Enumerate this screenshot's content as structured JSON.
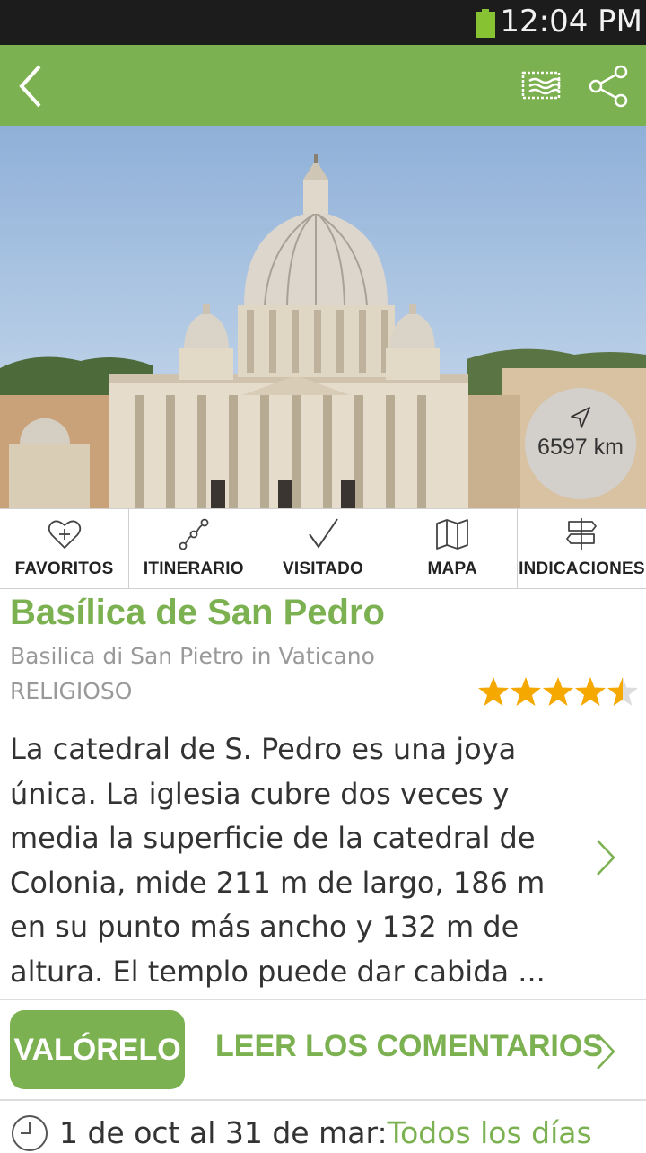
{
  "status_bar": {
    "time": "12:04 PM",
    "battery_color": "#86c232"
  },
  "app_bar": {
    "color": "#7cb151",
    "icons": [
      "back-arrow-icon",
      "postcard-icon",
      "share-icon"
    ]
  },
  "hero": {
    "distance": "6597 km",
    "icon": "navigation-arrow-icon"
  },
  "actions": [
    {
      "label": "FAVORITOS",
      "icon": "heart-plus-icon"
    },
    {
      "label": "ITINERARIO",
      "icon": "route-icon"
    },
    {
      "label": "VISITADO",
      "icon": "checkmark-icon"
    },
    {
      "label": "MAPA",
      "icon": "map-icon"
    },
    {
      "label": "INDICACIONES",
      "icon": "signpost-icon"
    }
  ],
  "place": {
    "title": "Basílica de San Pedro",
    "subtitle": "Basilica di San Pietro in Vaticano",
    "category": "RELIGIOSO",
    "rating": 4.5,
    "rating_max": 5,
    "description": "La catedral de S. Pedro es una joya única. La iglesia cubre dos veces y media la superficie de la catedral de Colonia, mide 211 m de largo, 186 m en su punto más ancho y 132 m de altura. El templo puede dar cabida ..."
  },
  "reviews": {
    "rate_label": "VALÓRELO",
    "comments_label": "LEER LOS COMENTARIOS"
  },
  "schedule": {
    "period": "1 de oct al 31 de mar:",
    "days": "Todos los días"
  },
  "colors": {
    "accent": "#7cb151",
    "star": "#f5a800"
  }
}
